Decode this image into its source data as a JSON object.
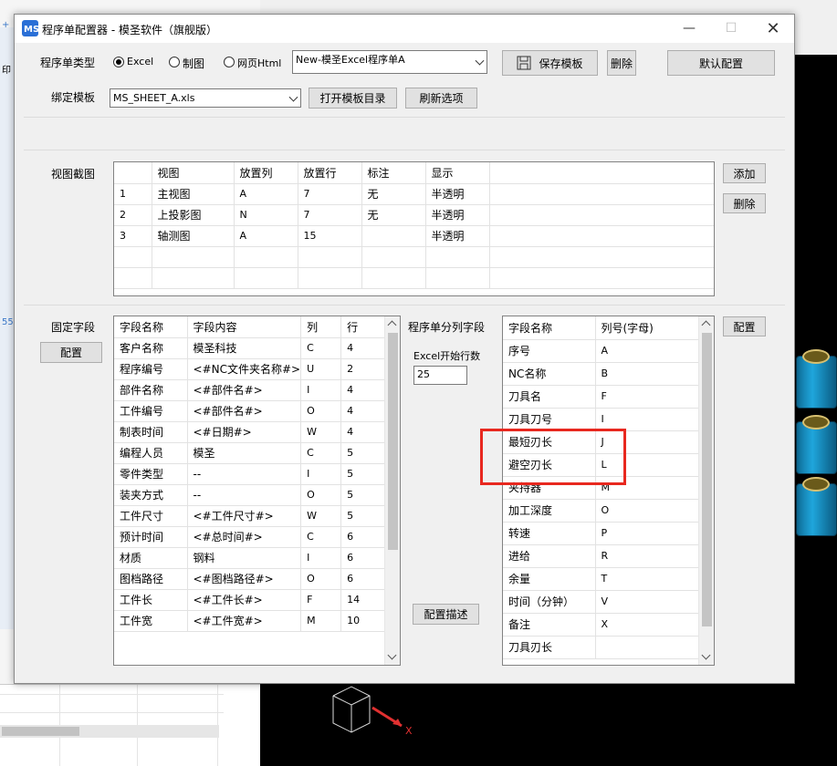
{
  "window": {
    "title": "程序单配置器 - 模圣软件（旗舰版）",
    "logo_text": "MS"
  },
  "type_row": {
    "label": "程序单类型",
    "options": [
      "Excel",
      "制图",
      "网页Html"
    ],
    "selected": "Excel",
    "template_value": "New-模圣Excel程序单A",
    "save_label": "保存模板",
    "delete_label": "删除",
    "default_label": "默认配置"
  },
  "bind_row": {
    "label": "绑定模板",
    "file_value": "MS_SHEET_A.xls",
    "open_dir_label": "打开模板目录",
    "refresh_label": "刷新选项"
  },
  "view_section": {
    "label": "视图截图",
    "headers": [
      "",
      "视图",
      "放置列",
      "放置行",
      "标注",
      "显示"
    ],
    "rows": [
      [
        "1",
        "主视图",
        "A",
        "7",
        "无",
        "半透明"
      ],
      [
        "2",
        "上投影图",
        "N",
        "7",
        "无",
        "半透明"
      ],
      [
        "3",
        "轴测图",
        "A",
        "15",
        "",
        "半透明"
      ]
    ],
    "add_label": "添加",
    "delete_label": "删除"
  },
  "fixed_section": {
    "label": "固定字段",
    "config_label": "配置",
    "headers": [
      "字段名称",
      "字段内容",
      "列",
      "行"
    ],
    "rows": [
      [
        "客户名称",
        "模圣科技",
        "C",
        "4"
      ],
      [
        "程序编号",
        "<#NC文件夹名称#>",
        "U",
        "2"
      ],
      [
        "部件名称",
        "<#部件名#>",
        "I",
        "4"
      ],
      [
        "工件编号",
        "<#部件名#>",
        "O",
        "4"
      ],
      [
        "制表时间",
        "<#日期#>",
        "W",
        "4"
      ],
      [
        "编程人员",
        "模圣",
        "C",
        "5"
      ],
      [
        "零件类型",
        "--",
        "I",
        "5"
      ],
      [
        "装夹方式",
        "--",
        "O",
        "5"
      ],
      [
        "工件尺寸",
        "<#工件尺寸#>",
        "W",
        "5"
      ],
      [
        "预计时间",
        "<#总时间#>",
        "C",
        "6"
      ],
      [
        "材质",
        "钢料",
        "I",
        "6"
      ],
      [
        "图档路径",
        "<#图档路径#>",
        "O",
        "6"
      ],
      [
        "工件长",
        "<#工件长#>",
        "F",
        "14"
      ],
      [
        "工件宽",
        "<#工件宽#>",
        "M",
        "10"
      ]
    ]
  },
  "column_section": {
    "label": "程序单分列字段",
    "start_row_label": "Excel开始行数",
    "start_row_value": "25",
    "describe_label": "配置描述",
    "config_label": "配置",
    "headers": [
      "字段名称",
      "列号(字母)"
    ],
    "rows": [
      [
        "序号",
        "A"
      ],
      [
        "NC名称",
        "B"
      ],
      [
        "刀具名",
        "F"
      ],
      [
        "刀具刀号",
        "I"
      ],
      [
        "最短刃长",
        "J"
      ],
      [
        "避空刃长",
        "L"
      ],
      [
        "夹持器",
        "M"
      ],
      [
        "加工深度",
        "O"
      ],
      [
        "转速",
        "P"
      ],
      [
        "进给",
        "R"
      ],
      [
        "余量",
        "T"
      ],
      [
        "时间（分钟）",
        "V"
      ],
      [
        "备注",
        "X"
      ],
      [
        "刀具刃长",
        ""
      ]
    ]
  },
  "background": {
    "left_edge_labels": [
      "+",
      "印",
      "55"
    ],
    "axis_label": "X"
  },
  "colors": {
    "highlight": "#e8281f",
    "viewport": "#000000",
    "part": "#1fa6dc"
  }
}
